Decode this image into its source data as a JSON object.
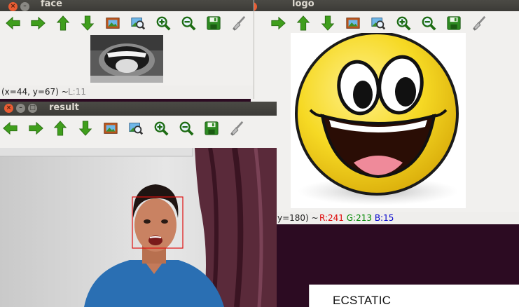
{
  "windows": {
    "face": {
      "title": "face",
      "status_coords": "(x=44, y=67) ~",
      "status_level": "L:11"
    },
    "logo": {
      "title": "logo",
      "status_coords": "y=180) ~",
      "status_r": "R:241",
      "status_g": "G:213",
      "status_b": "B:15"
    },
    "result": {
      "title": "result"
    }
  },
  "emotion_label": "ECSTATIC",
  "toolbar_icons": [
    "arrow-left-icon",
    "arrow-right-icon",
    "arrow-up-icon",
    "arrow-down-icon",
    "image-icon",
    "zoom-fit-icon",
    "zoom-in-icon",
    "zoom-out-icon",
    "save-icon",
    "brush-icon"
  ],
  "colors": {
    "desktop_bg": "#2c0b22",
    "arrow_green": "#3f9e1c",
    "face_box": "#e01010",
    "smiley_yellow": "#f3d21c"
  }
}
